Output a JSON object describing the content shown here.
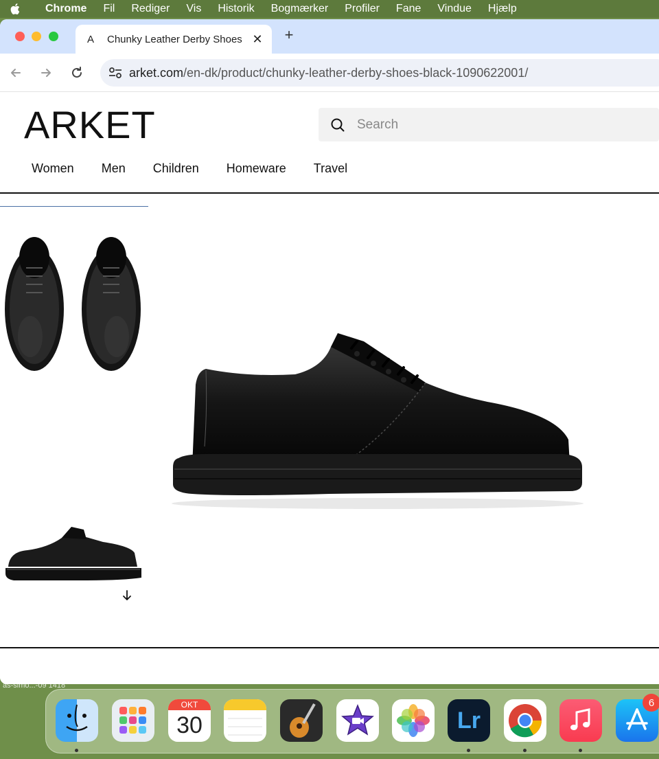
{
  "menubar": {
    "app": "Chrome",
    "items": [
      "Fil",
      "Rediger",
      "Vis",
      "Historik",
      "Bogmærker",
      "Profiler",
      "Fane",
      "Vindue",
      "Hjælp"
    ]
  },
  "browser": {
    "tab": {
      "favicon": "A",
      "title": "Chunky Leather Derby Shoes",
      "close": "✕"
    },
    "new_tab": "+",
    "url_host": "arket.com",
    "url_path": "/en-dk/product/chunky-leather-derby-shoes-black-1090622001/"
  },
  "site": {
    "logo": "ARKET",
    "search_placeholder": "Search",
    "nav": [
      "Women",
      "Men",
      "Children",
      "Homeware",
      "Travel"
    ]
  },
  "dock": {
    "calendar_month": "OKT",
    "calendar_day": "30",
    "appstore_badge": "6",
    "desktop_label": "as-simo...-09 1418",
    "apps": [
      "finder-icon",
      "launchpad-icon",
      "calendar-icon",
      "notes-icon",
      "garageband-icon",
      "imovie-icon",
      "photos-icon",
      "lightroom-icon",
      "chrome-icon",
      "music-icon",
      "appstore-icon"
    ]
  },
  "colors": {
    "tabstrip": "#d3e3fd",
    "omnibox": "#eef1f8",
    "accent_thumb": "#4a6fa5"
  }
}
